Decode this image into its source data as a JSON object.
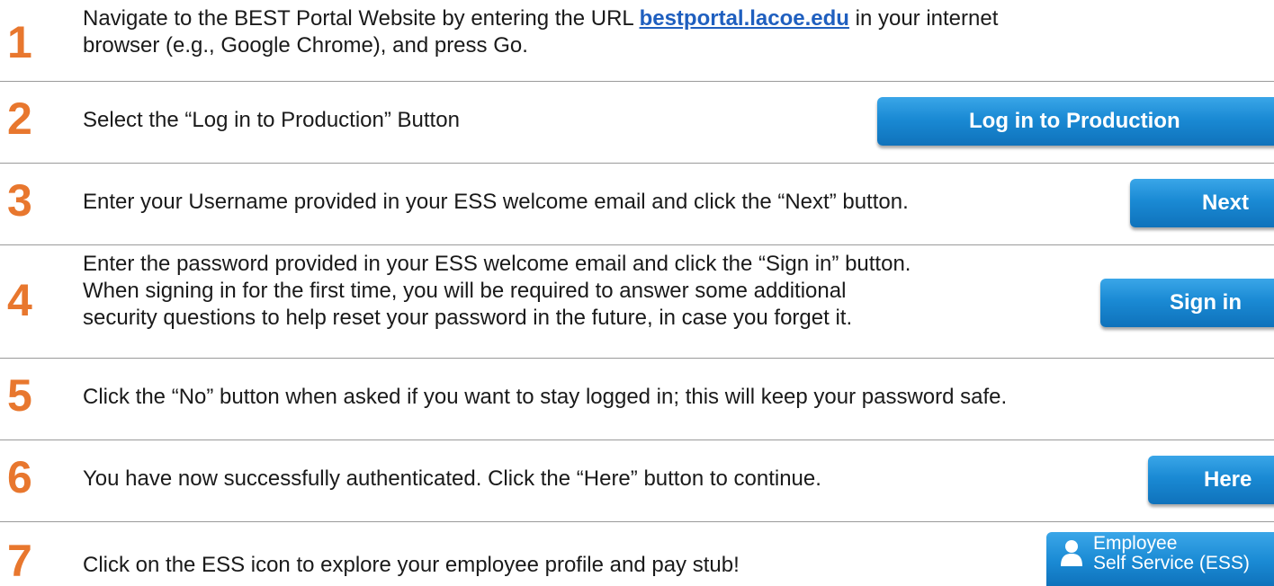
{
  "steps": [
    {
      "number": "1",
      "text_before": "Navigate to the BEST Portal Website by entering the URL ",
      "link": "bestportal.lacoe.edu",
      "text_after": " in your internet",
      "line2": "browser (e.g., Google Chrome), and press Go."
    },
    {
      "number": "2",
      "text": "Select the “Log in to Production” Button",
      "button": "Log in to Production"
    },
    {
      "number": "3",
      "text": "Enter your Username provided in your ESS welcome email and click the “Next” button.",
      "button": "Next"
    },
    {
      "number": "4",
      "lines": [
        "Enter the password provided in your ESS welcome email and click the “Sign in” button.",
        "When signing in for the first time, you will be required to answer some additional",
        "security questions to help reset your password in the future, in case you forget it."
      ],
      "button": "Sign in"
    },
    {
      "number": "5",
      "text": "Click the “No” button when asked if you want to stay logged in; this will keep your password safe."
    },
    {
      "number": "6",
      "text": "You have now successfully authenticated. Click the “Here” button to continue.",
      "button": "Here"
    },
    {
      "number": "7",
      "text": "Click on the ESS icon to explore your employee profile and pay stub!",
      "button_line1": "Employee",
      "button_line2": "Self Service (ESS)",
      "button_icon": "person-icon"
    }
  ],
  "colors": {
    "step_number": "#e8772e",
    "link": "#1f5fbf",
    "button": "#1a8ad4",
    "divider": "#9a9a9a"
  }
}
